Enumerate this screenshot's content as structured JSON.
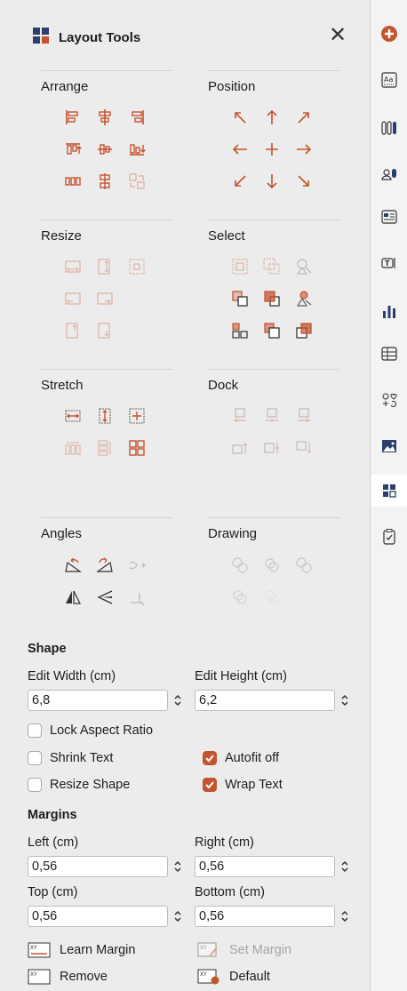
{
  "panel": {
    "title": "Layout Tools",
    "title_icon": "layout-grid-icon",
    "close_icon": "close-icon"
  },
  "sections": {
    "arrange": "Arrange",
    "position": "Position",
    "resize": "Resize",
    "select": "Select",
    "stretch": "Stretch",
    "dock": "Dock",
    "angles": "Angles",
    "drawing": "Drawing"
  },
  "shape": {
    "heading": "Shape",
    "edit_width_label": "Edit Width (cm)",
    "edit_width_value": "6,8",
    "edit_height_label": "Edit Height (cm)",
    "edit_height_value": "6,2",
    "lock_aspect_label": "Lock Aspect Ratio",
    "lock_aspect_checked": false,
    "shrink_text_label": "Shrink Text",
    "shrink_text_checked": false,
    "autofit_off_label": "Autofit off",
    "autofit_off_checked": true,
    "resize_shape_label": "Resize Shape",
    "resize_shape_checked": false,
    "wrap_text_label": "Wrap Text",
    "wrap_text_checked": true
  },
  "margins": {
    "heading": "Margins",
    "left_label": "Left (cm)",
    "left_value": "0,56",
    "right_label": "Right (cm)",
    "right_value": "0,56",
    "top_label": "Top (cm)",
    "top_value": "0,56",
    "bottom_label": "Bottom (cm)",
    "bottom_value": "0,56",
    "learn_margin": "Learn Margin",
    "set_margin": "Set Margin",
    "remove": "Remove",
    "default": "Default"
  },
  "colors": {
    "accent": "#c4542f",
    "disabled": "#b8b8b8"
  },
  "sidebar_icons": [
    "app-logo-icon",
    "styles-icon",
    "columns-icon",
    "people-icon",
    "form-icon",
    "text-box-icon",
    "chart-icon",
    "table-icon",
    "emoji-icon",
    "image-icon",
    "layout-tools-icon",
    "checklist-icon"
  ],
  "selected_sidebar_icon": "layout-tools-icon"
}
